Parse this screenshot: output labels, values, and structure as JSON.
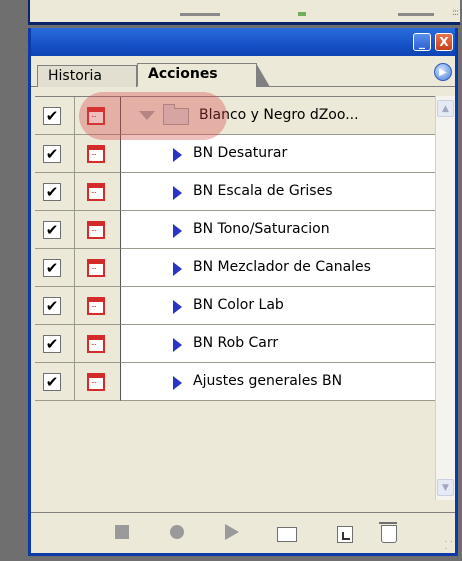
{
  "window": {
    "minimize_glyph": "_",
    "close_glyph": "X"
  },
  "tabs": [
    {
      "label": "Historia",
      "active": false
    },
    {
      "label": "Acciones",
      "active": true
    }
  ],
  "panel_menu_icon": "panel-menu-arrow-icon",
  "action_set": {
    "label": "Blanco y Negro dZoo...",
    "checked": true,
    "expanded": true
  },
  "actions": [
    {
      "label": "BN Desaturar",
      "checked": true
    },
    {
      "label": "BN Escala de Grises",
      "checked": true
    },
    {
      "label": "BN Tono/Saturacion",
      "checked": true
    },
    {
      "label": "BN Mezclador de Canales",
      "checked": true
    },
    {
      "label": "BN Color Lab",
      "checked": true
    },
    {
      "label": "BN Rob Carr",
      "checked": true
    },
    {
      "label": "Ajustes generales BN",
      "checked": true
    }
  ],
  "check_glyph": "✔",
  "toolbar": {
    "buttons": [
      "stop-icon",
      "record-icon",
      "play-icon",
      "new-set-icon",
      "new-action-icon",
      "trash-icon"
    ]
  },
  "colors": {
    "titlebar": "#1651c6",
    "dialog_icon": "#d42a2a",
    "highlight": "#d84646",
    "expand_triangle": "#2a35c8"
  }
}
